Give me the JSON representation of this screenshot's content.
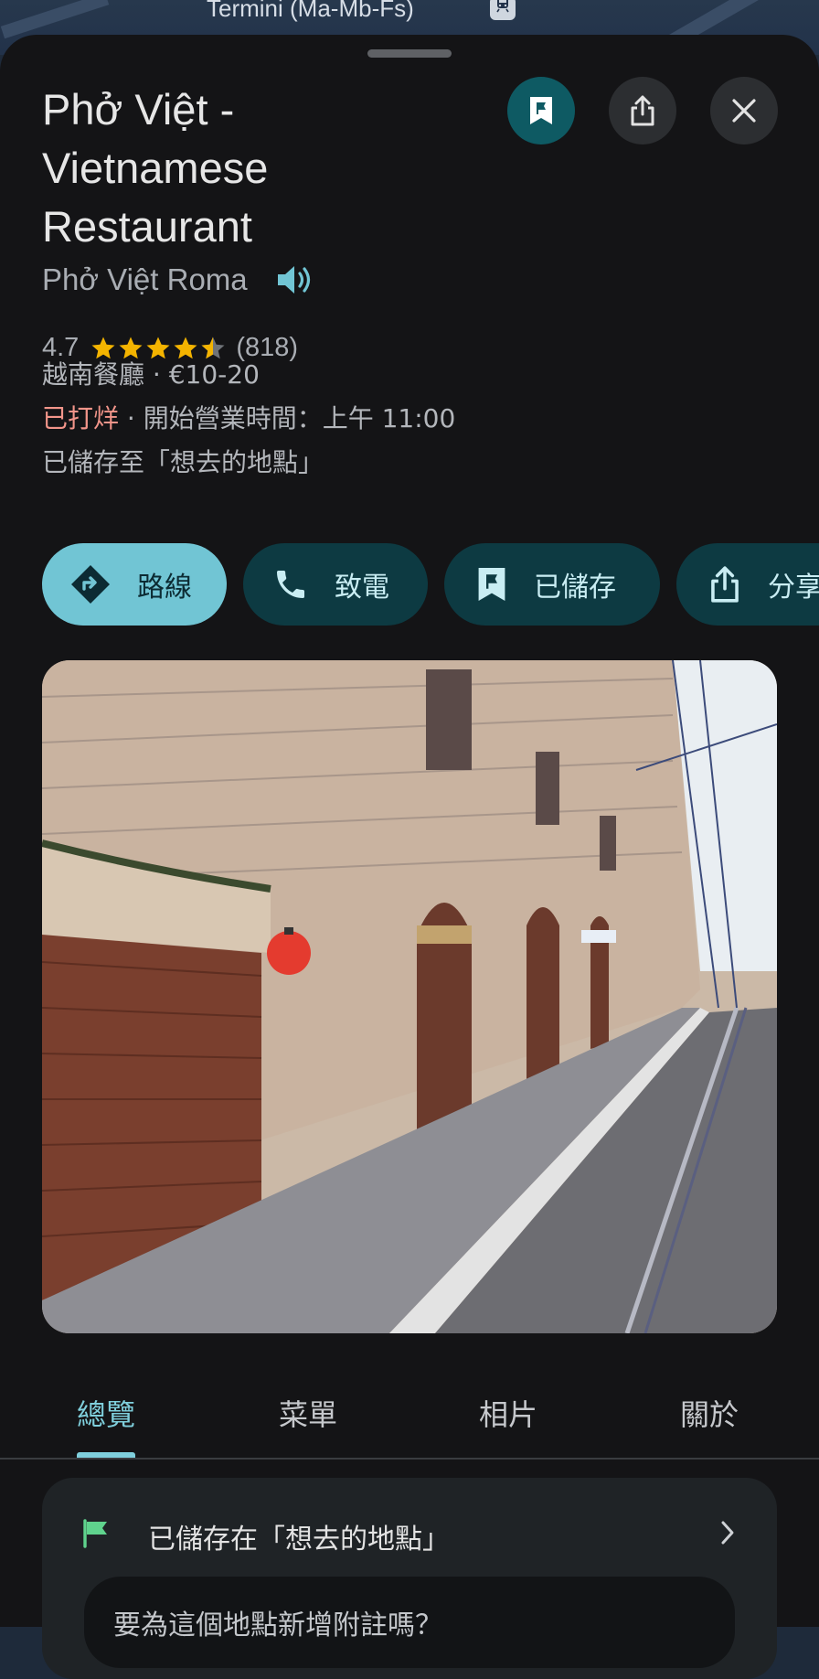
{
  "map": {
    "label": "Termini (Ma-Mb-Fs)",
    "pin_icon": "train-station-icon"
  },
  "place": {
    "name": "Phở Việt - Vietnamese Restaurant",
    "local_name": "Phở Việt Roma",
    "rating": "4.7",
    "rating_value": 4.7,
    "review_count": "(818)",
    "category_price": "越南餐廳 · €10-20",
    "status": "已打烊",
    "hours": " · 開始營業時間：上午 11:00",
    "saved_info": "已儲存至「想去的地點」"
  },
  "actions": {
    "directions": "路線",
    "call": "致電",
    "saved": "已儲存",
    "share": "分享"
  },
  "tabs": [
    {
      "label": "總覽",
      "active": true
    },
    {
      "label": "菜單",
      "active": false
    },
    {
      "label": "相片",
      "active": false
    },
    {
      "label": "關於",
      "active": false
    }
  ],
  "saved_card": {
    "text": "已儲存在「想去的地點」",
    "note_placeholder": "要為這個地點新增附註嗎？"
  },
  "colors": {
    "accent": "#71c5d4",
    "dark_pill": "#0d3a42",
    "closed": "#f2958a",
    "star": "#f4b400",
    "flag_green": "#5fd38d"
  }
}
